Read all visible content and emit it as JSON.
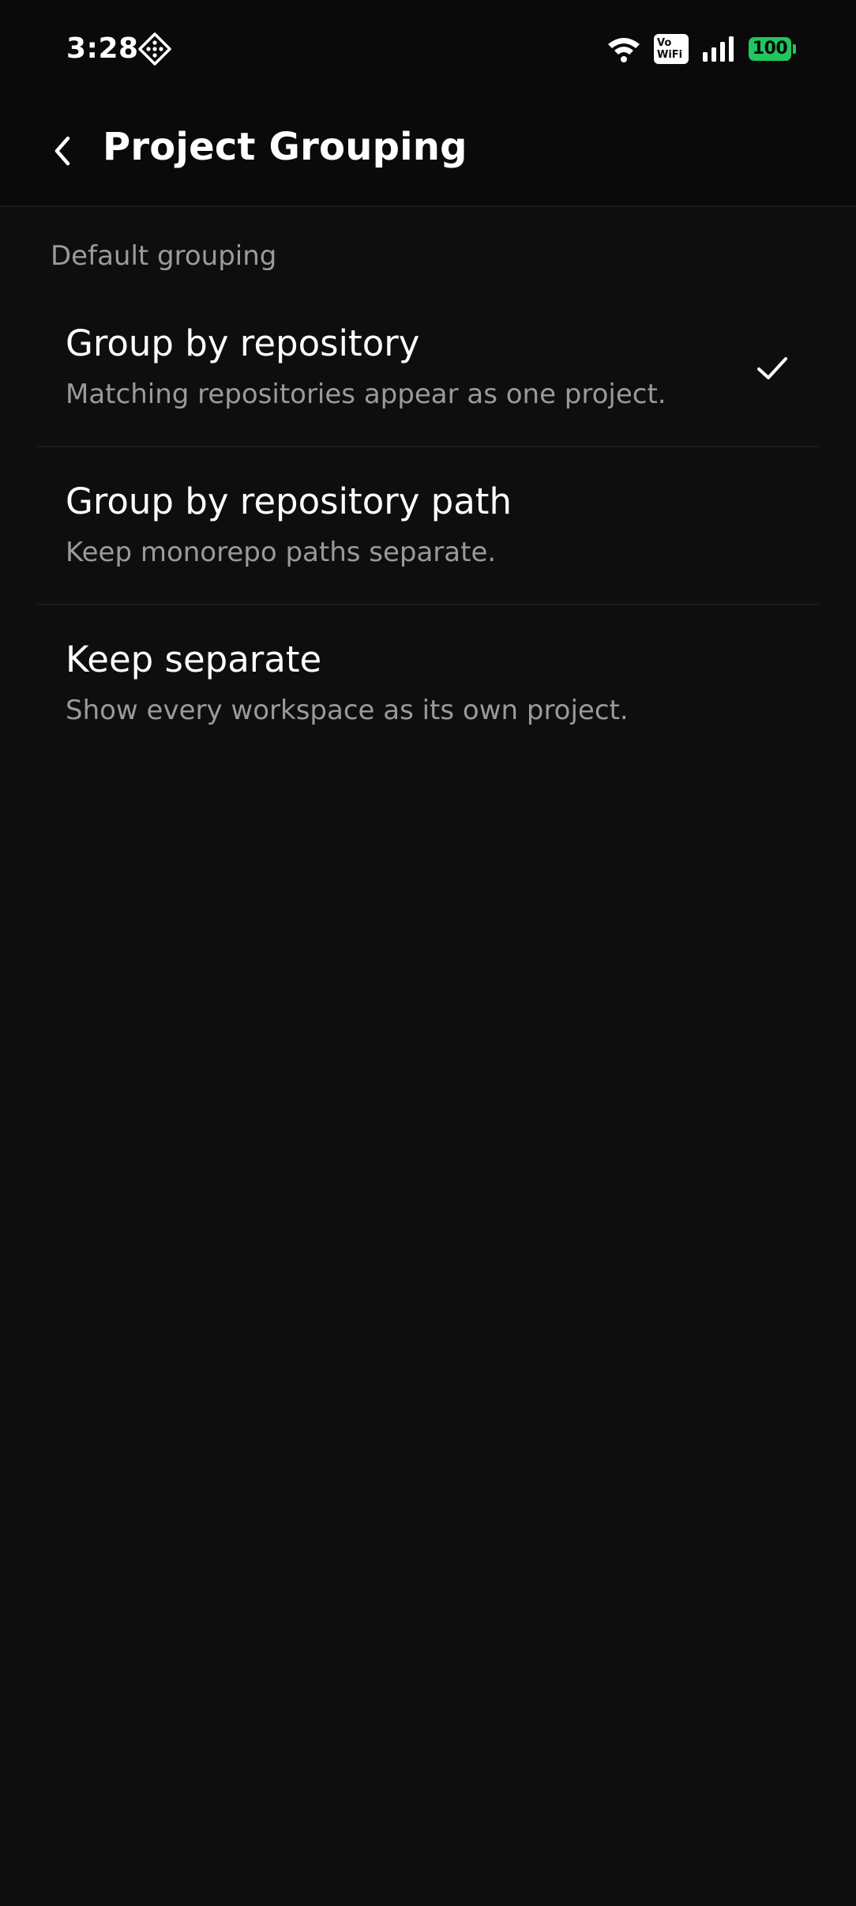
{
  "status_bar": {
    "time": "3:28",
    "vowifi_top": "Vo",
    "vowifi_bottom": "WiFi",
    "battery": "100",
    "battery_color": "#22c55e"
  },
  "app_bar": {
    "title": "Project Grouping",
    "back_icon": "chevron-left-icon"
  },
  "section": {
    "label": "Default grouping"
  },
  "options": [
    {
      "title": "Group by repository",
      "subtitle": "Matching repositories appear as one project.",
      "selected": true
    },
    {
      "title": "Group by repository path",
      "subtitle": "Keep monorepo paths separate.",
      "selected": false
    },
    {
      "title": "Keep separate",
      "subtitle": "Show every workspace as its own project.",
      "selected": false
    }
  ],
  "colors": {
    "background": "#0e0e0e",
    "header_background": "#0a0a0a",
    "text_primary": "#ffffff",
    "text_secondary": "#9a9a9a",
    "divider": "#1c1c1c"
  }
}
